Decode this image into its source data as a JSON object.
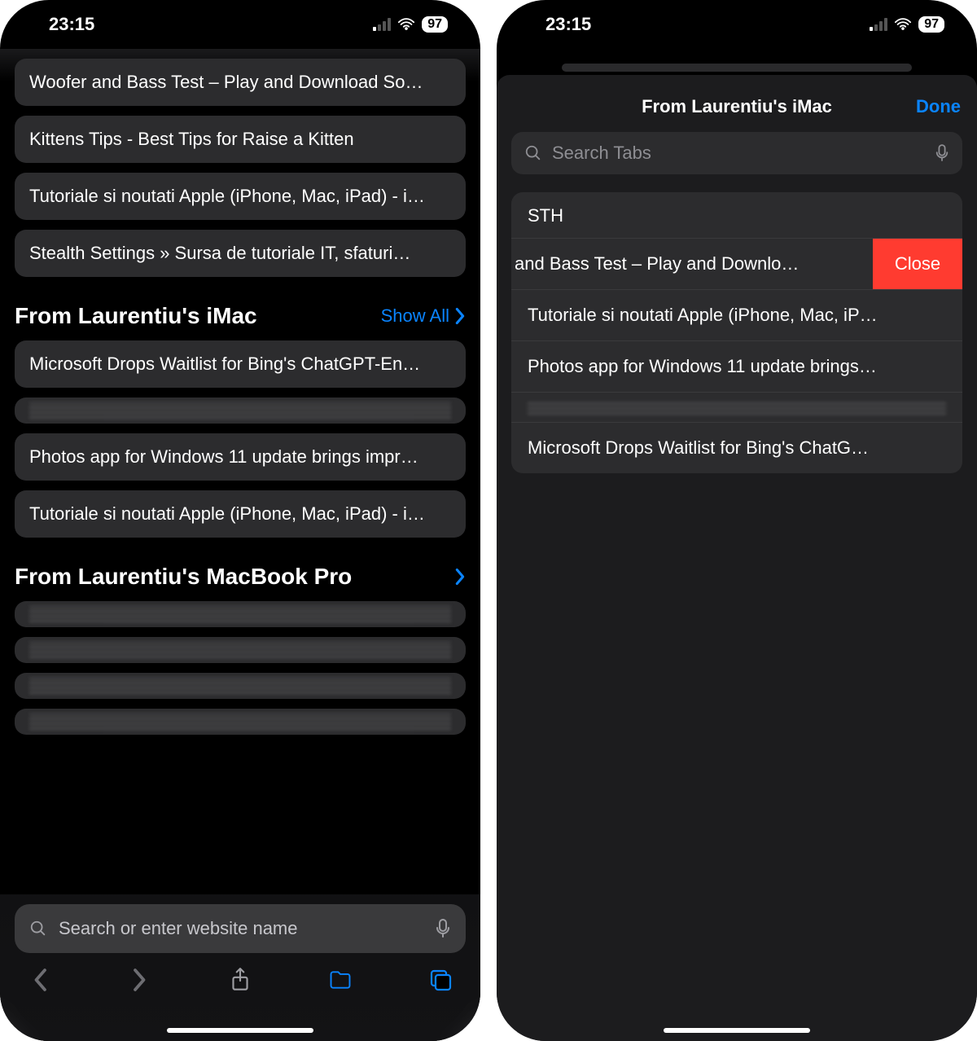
{
  "status": {
    "time": "23:15",
    "battery": "97"
  },
  "left": {
    "top_items": [
      "Woofer and Bass Test – Play and Download So…",
      "Kittens Tips - Best Tips for Raise a Kitten",
      "Tutoriale si noutati Apple (iPhone, Mac, iPad) - i…",
      "Stealth Settings » Sursa de tutoriale IT, sfaturi…"
    ],
    "section1": {
      "title": "From Laurentiu's iMac",
      "show_all": "Show All",
      "items": [
        "Microsoft Drops Waitlist for Bing's ChatGPT-En…",
        "",
        "Photos app for Windows 11 update brings impr…",
        "Tutoriale si noutati Apple (iPhone, Mac, iPad) - i…"
      ]
    },
    "section2": {
      "title": "From Laurentiu's MacBook Pro",
      "items": [
        "",
        "",
        "",
        ""
      ]
    },
    "url_placeholder": "Search or enter website name"
  },
  "right": {
    "sheet_title": "From Laurentiu's iMac",
    "done": "Done",
    "search_placeholder": "Search Tabs",
    "group_header": "STH",
    "rows": [
      {
        "label": "and Bass Test – Play and Downlo…",
        "close": "Close",
        "swiped": true
      },
      {
        "label": "Tutoriale si noutati Apple (iPhone, Mac, iP…"
      },
      {
        "label": "Photos app for Windows 11 update brings…"
      },
      {
        "label": "",
        "blur": true
      },
      {
        "label": "Microsoft Drops Waitlist for Bing's ChatG…"
      }
    ]
  }
}
